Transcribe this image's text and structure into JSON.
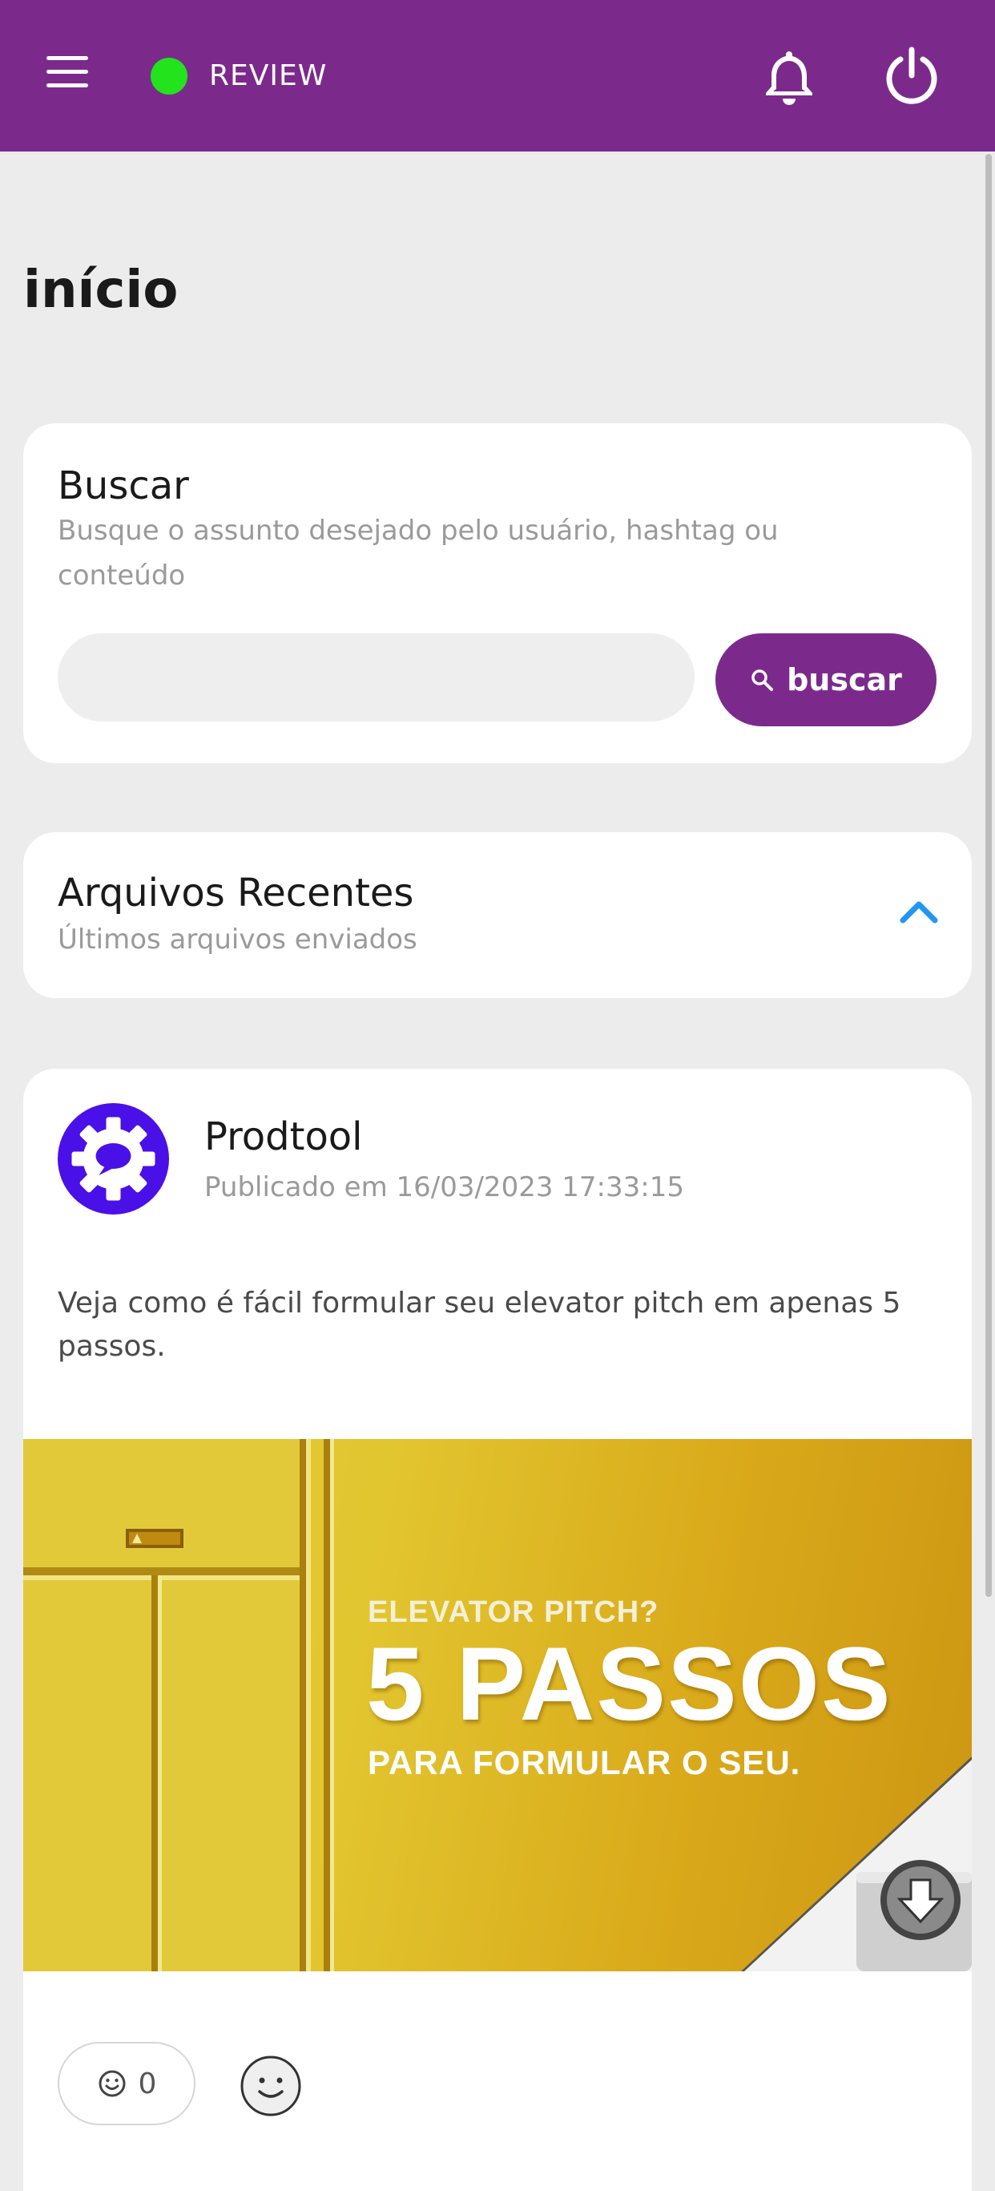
{
  "header": {
    "environment_label": "REVIEW",
    "status_color": "#22e31c",
    "menu_icon": "hamburger-menu-icon",
    "notifications_icon": "bell-icon",
    "logout_icon": "power-icon"
  },
  "page": {
    "title": "início"
  },
  "search": {
    "title": "Buscar",
    "subtitle": "Busque o assunto desejado pelo usuário, hashtag ou conteúdo",
    "input_value": "",
    "button_label": "buscar",
    "button_icon": "search-icon"
  },
  "recent_files": {
    "title": "Arquivos Recentes",
    "subtitle": "Últimos arquivos enviados",
    "toggle_icon": "chevron-up-icon"
  },
  "post": {
    "author": "Prodtool",
    "published": "Publicado em 16/03/2023 17:33:15",
    "text": "Veja como é fácil formular seu elevator pitch em apenas 5 passos.",
    "image": {
      "line1": "ELEVATOR PITCH?",
      "line2": "5 PASSOS",
      "line3": "PARA FORMULAR O SEU."
    },
    "reactions": {
      "count": "0",
      "icon": "smiley-icon",
      "add_icon": "add-reaction-icon"
    }
  },
  "colors": {
    "brand": "#7b2a8c",
    "avatar": "#4a10e8",
    "accent_chevron": "#2196f3",
    "background": "#ececec"
  }
}
